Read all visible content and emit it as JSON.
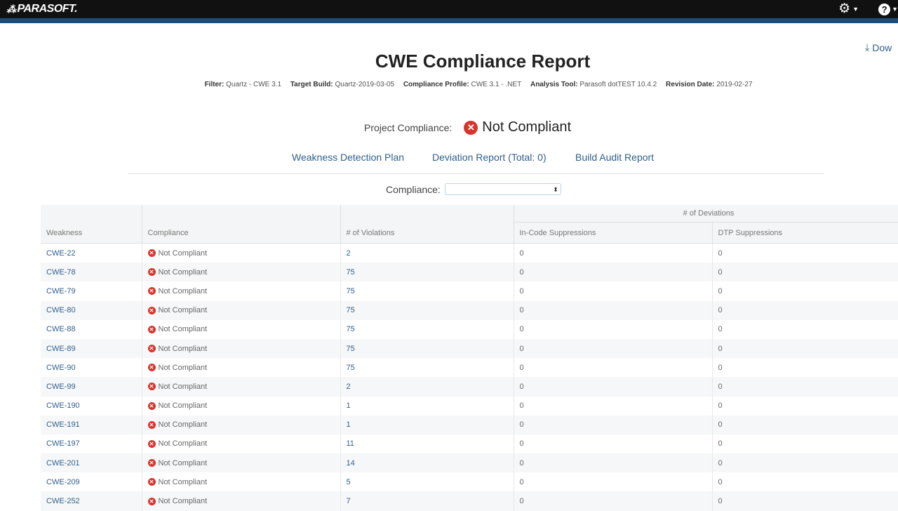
{
  "app": {
    "logo_text": "PARASOFT.",
    "logo_mark": "⁂"
  },
  "topbar": {
    "settings_icon": "gear-icon",
    "help_icon": "help-icon",
    "help_glyph": "?"
  },
  "download": {
    "label": "Dow"
  },
  "report": {
    "title": "CWE Compliance Report",
    "meta": {
      "filter_label": "Filter:",
      "filter_value": "Quartz - CWE 3.1",
      "build_label": "Target Build:",
      "build_value": "Quartz-2019-03-05",
      "profile_label": "Compliance Profile:",
      "profile_value": "CWE 3.1 - .NET",
      "tool_label": "Analysis Tool:",
      "tool_value": "Parasoft dotTEST 10.4.2",
      "date_label": "Revision Date:",
      "date_value": "2019-02-27"
    },
    "project_compliance": {
      "label": "Project Compliance:",
      "status": "Not Compliant"
    },
    "links": {
      "detection_plan": "Weakness Detection Plan",
      "deviation_report": "Deviation Report (Total: 0)",
      "build_audit": "Build Audit Report"
    },
    "filter": {
      "label": "Compliance:",
      "selected": ""
    }
  },
  "table": {
    "group_header": "# of Deviations",
    "columns": {
      "weakness": "Weakness",
      "compliance": "Compliance",
      "violations": "# of Violations",
      "in_code": "In-Code Suppressions",
      "dtp": "DTP Suppressions"
    },
    "rows": [
      {
        "weakness": "CWE-22",
        "compliance": "Not Compliant",
        "violations": "2",
        "in_code": "0",
        "dtp": "0"
      },
      {
        "weakness": "CWE-78",
        "compliance": "Not Compliant",
        "violations": "75",
        "in_code": "0",
        "dtp": "0"
      },
      {
        "weakness": "CWE-79",
        "compliance": "Not Compliant",
        "violations": "75",
        "in_code": "0",
        "dtp": "0"
      },
      {
        "weakness": "CWE-80",
        "compliance": "Not Compliant",
        "violations": "75",
        "in_code": "0",
        "dtp": "0"
      },
      {
        "weakness": "CWE-88",
        "compliance": "Not Compliant",
        "violations": "75",
        "in_code": "0",
        "dtp": "0"
      },
      {
        "weakness": "CWE-89",
        "compliance": "Not Compliant",
        "violations": "75",
        "in_code": "0",
        "dtp": "0"
      },
      {
        "weakness": "CWE-90",
        "compliance": "Not Compliant",
        "violations": "75",
        "in_code": "0",
        "dtp": "0"
      },
      {
        "weakness": "CWE-99",
        "compliance": "Not Compliant",
        "violations": "2",
        "in_code": "0",
        "dtp": "0"
      },
      {
        "weakness": "CWE-190",
        "compliance": "Not Compliant",
        "violations": "1",
        "in_code": "0",
        "dtp": "0"
      },
      {
        "weakness": "CWE-191",
        "compliance": "Not Compliant",
        "violations": "1",
        "in_code": "0",
        "dtp": "0"
      },
      {
        "weakness": "CWE-197",
        "compliance": "Not Compliant",
        "violations": "11",
        "in_code": "0",
        "dtp": "0"
      },
      {
        "weakness": "CWE-201",
        "compliance": "Not Compliant",
        "violations": "14",
        "in_code": "0",
        "dtp": "0"
      },
      {
        "weakness": "CWE-209",
        "compliance": "Not Compliant",
        "violations": "5",
        "in_code": "0",
        "dtp": "0"
      },
      {
        "weakness": "CWE-252",
        "compliance": "Not Compliant",
        "violations": "7",
        "in_code": "0",
        "dtp": "0"
      }
    ]
  },
  "colors": {
    "accent": "#2f5f8c",
    "error": "#d9342b",
    "topbar": "#111111",
    "topbar_border": "#1e4d7b"
  }
}
